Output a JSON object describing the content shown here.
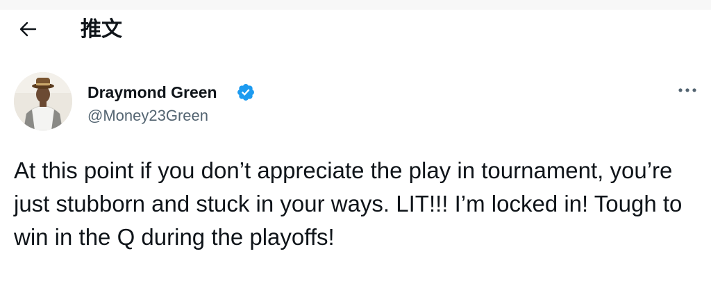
{
  "header": {
    "back_icon": "arrow-left-icon",
    "title": "推文"
  },
  "tweet": {
    "author": {
      "display_name": "Draymond Green",
      "handle": "@Money23Green",
      "verified": true,
      "verified_icon": "verified-badge-icon",
      "verified_color": "#1d9bf0"
    },
    "more_icon": "more-dots-icon",
    "text": "At this point if you don’t appreciate the play in tournament, you’re just stubborn and stuck in your ways. LIT!!! I’m locked in! Tough to win in the Q during the playoffs!"
  },
  "colors": {
    "text_primary": "#0f1419",
    "text_secondary": "#536471",
    "accent": "#1d9bf0"
  }
}
